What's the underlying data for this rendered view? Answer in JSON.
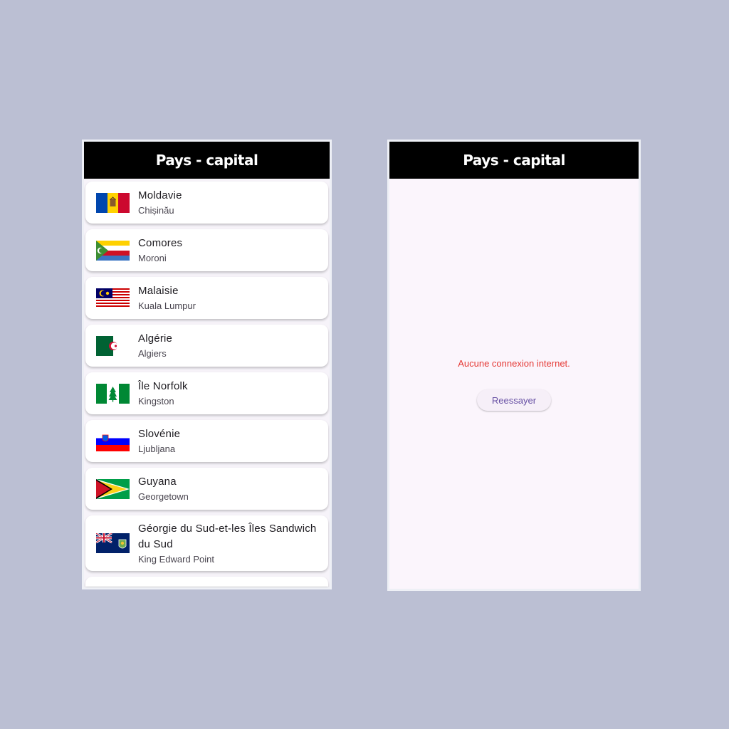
{
  "left_screen": {
    "title": "Pays - capital",
    "countries": [
      {
        "name": "Moldavie",
        "capital": "Chișinău",
        "flag_icon": "moldova-flag-icon"
      },
      {
        "name": "Comores",
        "capital": "Moroni",
        "flag_icon": "comoros-flag-icon"
      },
      {
        "name": "Malaisie",
        "capital": "Kuala Lumpur",
        "flag_icon": "malaysia-flag-icon"
      },
      {
        "name": "Algérie",
        "capital": "Algiers",
        "flag_icon": "algeria-flag-icon"
      },
      {
        "name": "Île Norfolk",
        "capital": "Kingston",
        "flag_icon": "norfolk-island-flag-icon"
      },
      {
        "name": "Slovénie",
        "capital": "Ljubljana",
        "flag_icon": "slovenia-flag-icon"
      },
      {
        "name": "Guyana",
        "capital": "Georgetown",
        "flag_icon": "guyana-flag-icon"
      },
      {
        "name": "Géorgie du Sud-et-les Îles Sandwich du Sud",
        "capital": "King Edward Point",
        "flag_icon": "south-georgia-flag-icon"
      }
    ]
  },
  "right_screen": {
    "title": "Pays - capital",
    "error_message": "Aucune connexion internet.",
    "retry_label": "Reessayer"
  },
  "colors": {
    "background": "#bbbfd3",
    "appbar": "#000000",
    "error": "#e53935",
    "button_text": "#6750a4"
  }
}
